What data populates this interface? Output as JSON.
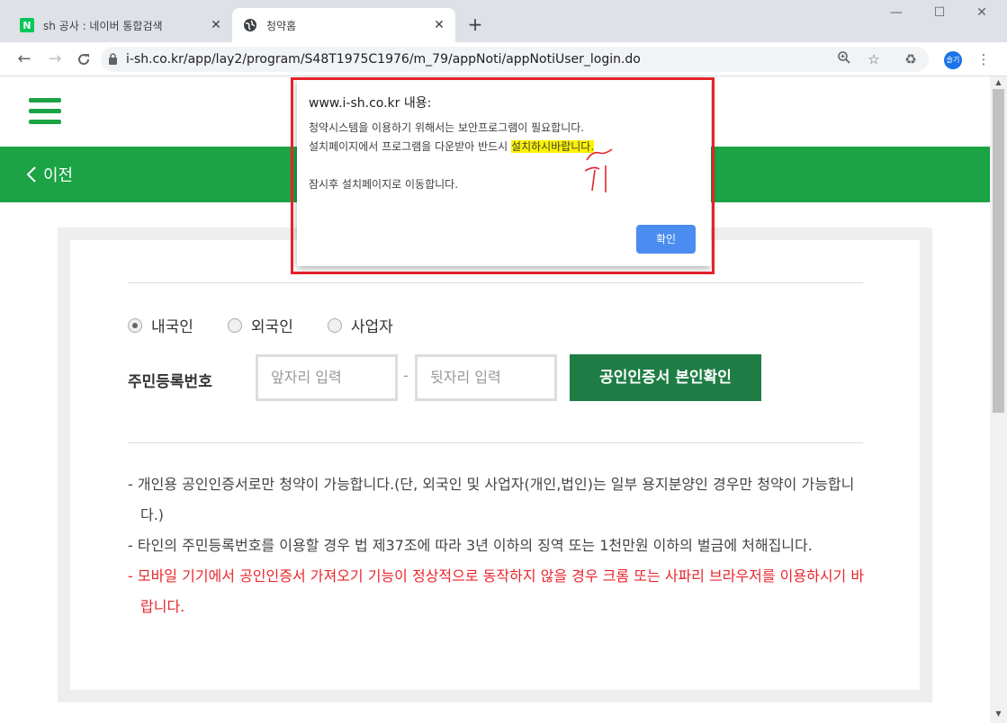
{
  "browser": {
    "tabs": [
      {
        "favicon": "naver-icon",
        "favicon_text": "N",
        "title": "sh 공사 : 네이버 통합검색",
        "active": false
      },
      {
        "favicon": "globe-icon",
        "title": "청약홈",
        "active": true
      }
    ],
    "new_tab": "+",
    "window_controls": {
      "minimize": "—",
      "maximize": "☐",
      "close": "✕"
    },
    "url": "i-sh.co.kr/app/lay2/program/S48T1975C1976/m_79/appNoti/appNotiUser_login.do",
    "profile_initials": "슬기"
  },
  "header": {
    "back_label": "이전",
    "accent_color": "#1ba345"
  },
  "form": {
    "radio_options": [
      {
        "label": "내국인",
        "selected": true
      },
      {
        "label": "외국인",
        "selected": false
      },
      {
        "label": "사업자",
        "selected": false
      }
    ],
    "id_label": "주민등록번호",
    "front_placeholder": "앞자리 입력",
    "back_placeholder": "뒷자리 입력",
    "separator": "-",
    "cert_button": "공인인증서 본인확인",
    "cert_button_color": "#1e7d44"
  },
  "notes": [
    {
      "text": "- 개인용 공인인증서로만 청약이 가능합니다.(단, 외국인 및 사업자(개인,법인)는 일부 용지분양인 경우만 청약이 가능합니다.)",
      "color": "#444444"
    },
    {
      "text": "- 타인의 주민등록번호를 이용할 경우 법 제37조에 따라 3년 이하의 징역 또는 1천만원 이하의 벌금에 처해집니다.",
      "color": "#444444"
    },
    {
      "text": "- 모바일 기기에서 공인인증서 가져오기 기능이 정상적으로 동작하지 않을 경우 크롬 또는 사파리 브라우저를 이용하시기 바랍니다.",
      "color": "#e8262c"
    }
  ],
  "dialog": {
    "title": "www.i-sh.co.kr 내용:",
    "line1": "청약시스템을 이용하기 위해서는 보안프로그램이 필요합니다.",
    "line2_prefix": "설치페이지에서 프로그램을 다운받아 반드시 ",
    "line2_highlight": "설치하시바랍니다.",
    "line3": "잠시후 설치페이지로 이동합니다.",
    "ok_label": "확인",
    "annotation_color": "#e5232a",
    "highlight_color": "#fff200"
  }
}
